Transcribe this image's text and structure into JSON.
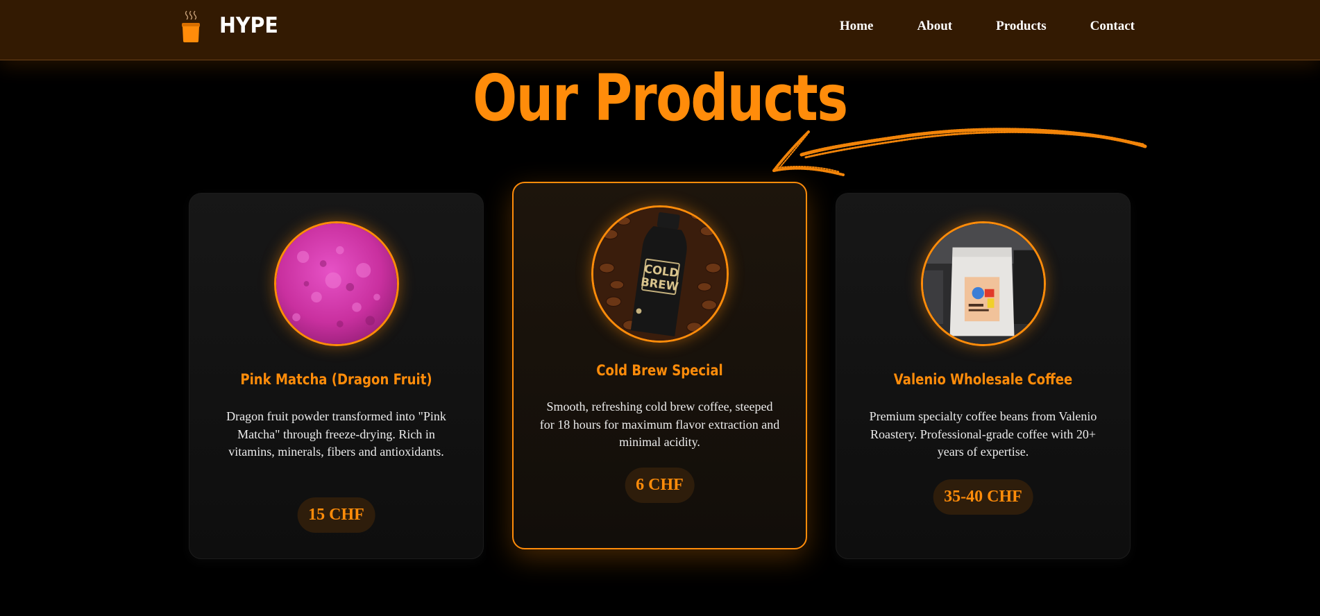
{
  "header": {
    "brand": "HYPE",
    "logo_icon": "coffee-cup-icon",
    "nav": [
      "Home",
      "About",
      "Products",
      "Contact"
    ]
  },
  "main": {
    "title": "Our Products",
    "decoration": "hand-drawn-arrow-icon"
  },
  "products": [
    {
      "name": "Pink Matcha (Dragon Fruit)",
      "description": "Dragon fruit powder transformed into \"Pink Matcha\" through freeze-drying. Rich in vitamins, minerals, fibers and antioxidants.",
      "price": "15 CHF",
      "image": "pink-powder-image",
      "featured": false
    },
    {
      "name": "Cold Brew Special",
      "description": "Smooth, refreshing cold brew coffee, steeped for 18 hours for maximum flavor extraction and minimal acidity.",
      "price": "6 CHF",
      "image": "cold-brew-bottle-image",
      "bottle_label": [
        "COLD",
        "BREW"
      ],
      "featured": true
    },
    {
      "name": "Valenio Wholesale Coffee",
      "description": "Premium specialty coffee beans from Valenio Roastery. Professional-grade coffee with 20+ years of expertise.",
      "price": "35-40 CHF",
      "image": "coffee-bag-image",
      "featured": false
    }
  ],
  "colors": {
    "accent": "#ff8c0a",
    "header_bg": "#331a02",
    "page_bg": "#000000",
    "card_bg": "#141414",
    "price_bg": "#2e1d0b",
    "text": "#ececec"
  }
}
